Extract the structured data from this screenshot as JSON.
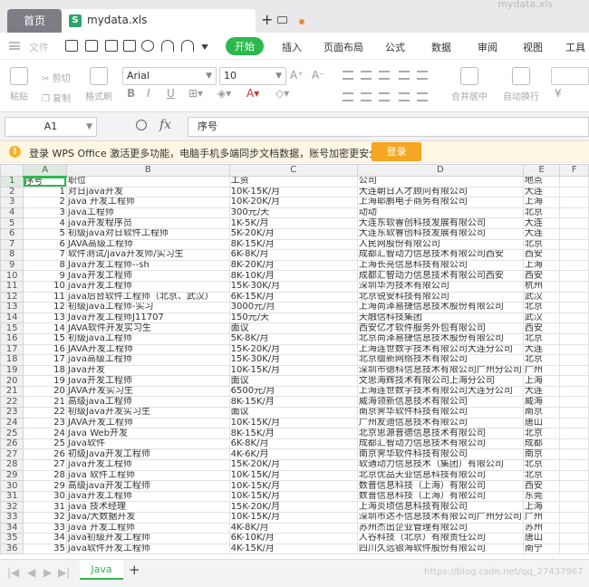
{
  "titlebar": {
    "home_tab": "首页",
    "doc_tab": "mydata.xls",
    "xls_badge": "S",
    "new_tab": "+",
    "window_title": "mydata.xls"
  },
  "menubar": {
    "file": "文件",
    "tabs": [
      "开始",
      "插入",
      "页面布局",
      "公式",
      "数据",
      "审阅",
      "视图",
      "工具"
    ]
  },
  "ribbon": {
    "paste": "粘贴",
    "cut": "剪切",
    "copy": "复制",
    "format_painter": "格式刷",
    "font_name": "Arial",
    "font_size": "10",
    "bold": "B",
    "italic": "I",
    "underline": "U",
    "merge_center": "合并居中",
    "auto_wrap": "自动换行",
    "currency": "¥"
  },
  "formula": {
    "cell_ref": "A1",
    "fx": "fx",
    "content": "序号"
  },
  "notice": {
    "message": "登录 WPS Office 激活更多功能，电脑手机多端同步文档数据，账号加密更安全。",
    "login": "登录"
  },
  "grid": {
    "columns": [
      "A",
      "B",
      "C",
      "D",
      "E",
      "F"
    ],
    "rows": [
      [
        "序号",
        "职位",
        "工资",
        "公司",
        "地点"
      ],
      [
        "1",
        "对日java开发",
        "10K-15K/月",
        "大连朝日人才顾问有限公司",
        "大连"
      ],
      [
        "2",
        "java 开发工程师",
        "10K-20K/月",
        "上海耶鹏电子商务有限公司",
        "上海"
      ],
      [
        "3",
        "java工程师",
        "300元/天",
        "动动",
        "北京"
      ],
      [
        "4",
        "java开发程序员",
        "1K-5K/月",
        "大连东软睿创科技发展有限公司",
        "大连"
      ],
      [
        "5",
        "初级java对日软件工程师",
        "5K-20K/月",
        "大连东软睿创科技发展有限公司",
        "大连"
      ],
      [
        "6",
        "JAVA高级工程师",
        "8K-15K/月",
        "人民网股份有限公司",
        "北京"
      ],
      [
        "7",
        "软件测试/java开发师/实习生",
        "6K-8K/月",
        "成都汇智动力信息技术有限公司西安",
        "西安"
      ],
      [
        "8",
        "Java开发工程师--sh",
        "8K-20K/月",
        "上海长亮信息科技有限公司",
        "上海"
      ],
      [
        "9",
        "Java开发工程师",
        "8K-10K/月",
        "成都汇智动力信息技术有限公司西安",
        "西安"
      ],
      [
        "10",
        "java开发工程师",
        "15K-30K/月",
        "深圳华为技术有限公司",
        "杭州"
      ],
      [
        "11",
        "java后台软件工程师（北京、武汉）",
        "6K-15K/月",
        "北京锐安科技有限公司",
        "武汉"
      ],
      [
        "12",
        "初级java工程师-实习",
        "3000元/月",
        "上海尚泽易捷信息技术股份有限公司",
        "北京"
      ],
      [
        "13",
        "Java开发工程师J11707",
        "150元/天",
        "天融信科技集团",
        "武汉"
      ],
      [
        "14",
        "JAVA软件开发实习生",
        "面议",
        "西安亿才软件服务外包有限公司",
        "西安"
      ],
      [
        "15",
        "初级java工程师",
        "5K-8K/月",
        "北京尚泽易捷信息技术股份有限公司",
        "北京"
      ],
      [
        "16",
        "JAVA开发工程师",
        "15K-20K/月",
        "上海连世数字技术有限公司大连分公司",
        "大连"
      ],
      [
        "17",
        "java高级工程师",
        "15K-30K/月",
        "北京缀新网络技术有限公司",
        "北京"
      ],
      [
        "18",
        "Java开发",
        "10K-15K/月",
        "深圳市德科信息技术有限公司广州分公司",
        "广州"
      ],
      [
        "19",
        "Java开发工程师",
        "面议",
        "文思海辉技术有限公司上海分公司",
        "上海"
      ],
      [
        "20",
        "JAVA开发实习生",
        "6500元/月",
        "上海连世数字技术有限公司大连分公司",
        "大连"
      ],
      [
        "21",
        "高级java工程师",
        "8K-15K/月",
        "威海领新信息技术有限公司",
        "威海"
      ],
      [
        "22",
        "初级Java开发实习生",
        "面议",
        "南京霁华软件科技有限公司",
        "南京"
      ],
      [
        "23",
        "JAVA开发工程师",
        "10K-15K/月",
        "广州友迪信息技术有限公司",
        "唐山"
      ],
      [
        "24",
        "Java Web开发",
        "8K-15K/月",
        "北京思源普德信息技术有限公司",
        "北京"
      ],
      [
        "25",
        "Java软件",
        "6K-8K/月",
        "成都汇智动力信息技术有限公司",
        "成都"
      ],
      [
        "26",
        "初级Java开发工程师",
        "4K-6K/月",
        "南京霁华软件科技有限公司",
        "南京"
      ],
      [
        "27",
        "java开发工程师",
        "15K-20K/月",
        "软通动力信息技术（集团）有限公司",
        "北京"
      ],
      [
        "28",
        "java 软件工程师",
        "10K-15K/月",
        "北京优品天业信息科技有限公司",
        "北京"
      ],
      [
        "29",
        "高级java开发工程师",
        "10K-15K/月",
        "数普信息科技（上海）有限公司",
        "西安"
      ],
      [
        "30",
        "java开发工程师",
        "10K-15K/月",
        "数普信息科技（上海）有限公司",
        "东莞"
      ],
      [
        "31",
        "java 技术经理",
        "15K-20K/月",
        "上海炎顷信息科技有限公司",
        "上海"
      ],
      [
        "32",
        "Java/大数据开发",
        "10K-15K/月",
        "深圳市达不信息技术有限公司广州分公司",
        "广州"
      ],
      [
        "33",
        "java 开发工程师",
        "4K-8K/月",
        "苏州杰出企业管理有限公司",
        "苏州"
      ],
      [
        "34",
        "java初级开发工程师",
        "6K-10K/月",
        "人谷科技（北京）有限责任公司",
        "唐山"
      ],
      [
        "35",
        "java软件开发工程师",
        "4K-15K/月",
        "四川久远银海软件股份有限公司",
        "南宁"
      ]
    ]
  },
  "sheets": {
    "tab": "Java",
    "add": "+",
    "watermark": "https://blog.csdn.net/qq_27437967"
  }
}
